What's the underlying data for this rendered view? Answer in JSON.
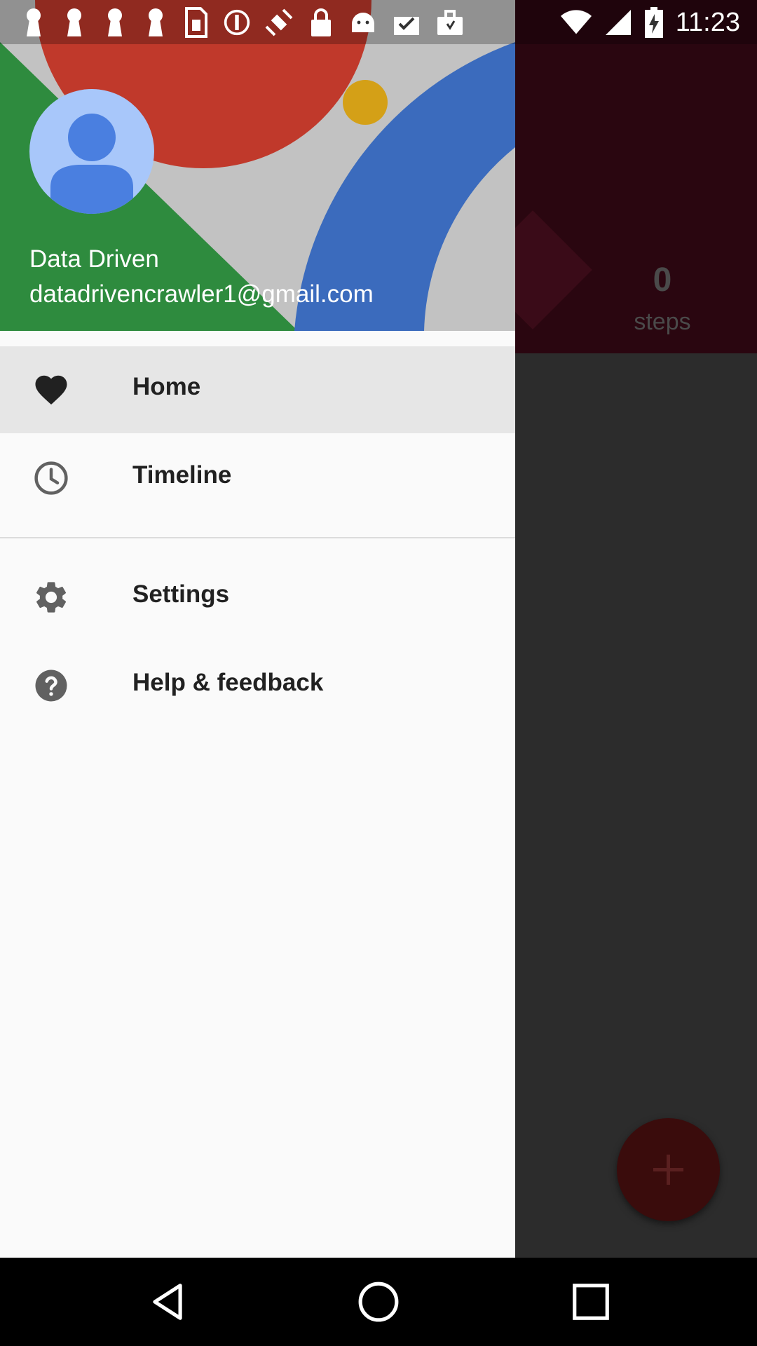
{
  "status_bar": {
    "time": "11:23",
    "left_icons": [
      "keyhole-icon",
      "keyhole-icon",
      "keyhole-icon",
      "keyhole-icon",
      "sim-card-icon",
      "alert-circle-icon",
      "fake-gps-icon",
      "lock-icon",
      "android-icon",
      "clipboard-check-icon",
      "briefcase-icon"
    ],
    "right_icons": [
      "wifi-icon",
      "signal-icon",
      "battery-charging-icon"
    ]
  },
  "drawer": {
    "user_name": "Data Driven",
    "user_email": "datadrivencrawler1@gmail.com",
    "menu": [
      {
        "label": "Home",
        "icon": "heart-icon",
        "active": true
      },
      {
        "label": "Timeline",
        "icon": "clock-icon",
        "active": false
      },
      {
        "label": "Settings",
        "icon": "gear-icon",
        "active": false
      },
      {
        "label": "Help & feedback",
        "icon": "help-icon",
        "active": false
      }
    ]
  },
  "background": {
    "steps_count": "0",
    "steps_label": "steps"
  },
  "nav_bar": {
    "buttons": [
      "back-icon",
      "home-icon",
      "recents-icon"
    ]
  },
  "colors": {
    "header_red": "#c0392b",
    "header_green": "#2e8b3e",
    "header_blue": "#3b6bbd",
    "header_yellow": "#d4a017",
    "avatar_bg": "#a8c7fa",
    "avatar_fg": "#4a7fe0"
  }
}
